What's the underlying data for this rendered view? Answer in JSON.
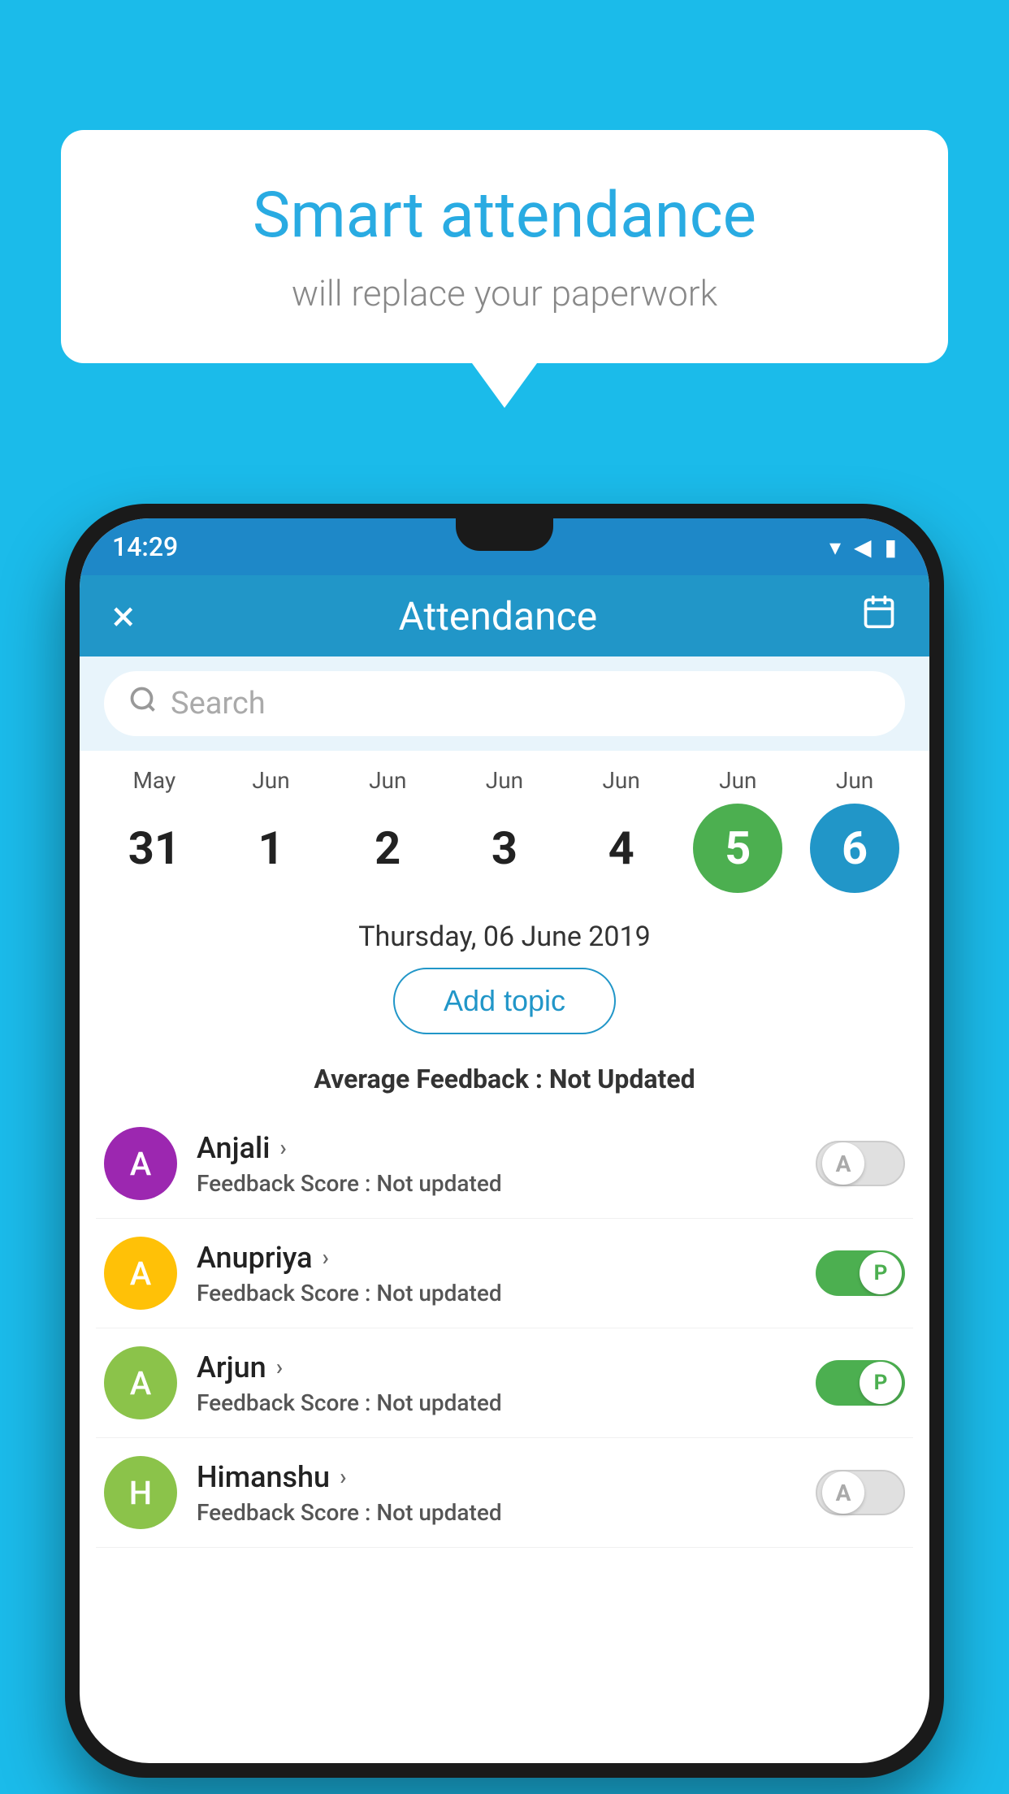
{
  "background_color": "#1BBBEA",
  "speech_bubble": {
    "title": "Smart attendance",
    "subtitle": "will replace your paperwork"
  },
  "status_bar": {
    "time": "14:29",
    "icons": [
      "wifi",
      "signal",
      "battery"
    ]
  },
  "app_bar": {
    "title": "Attendance",
    "close_label": "×",
    "calendar_label": "📅"
  },
  "search": {
    "placeholder": "Search"
  },
  "calendar": {
    "days": [
      {
        "month": "May",
        "date": "31",
        "state": "normal"
      },
      {
        "month": "Jun",
        "date": "1",
        "state": "normal"
      },
      {
        "month": "Jun",
        "date": "2",
        "state": "normal"
      },
      {
        "month": "Jun",
        "date": "3",
        "state": "normal"
      },
      {
        "month": "Jun",
        "date": "4",
        "state": "normal"
      },
      {
        "month": "Jun",
        "date": "5",
        "state": "today"
      },
      {
        "month": "Jun",
        "date": "6",
        "state": "selected"
      }
    ]
  },
  "selected_date": "Thursday, 06 June 2019",
  "add_topic_label": "Add topic",
  "avg_feedback": {
    "label": "Average Feedback : ",
    "value": "Not Updated"
  },
  "students": [
    {
      "name": "Anjali",
      "avatar_letter": "A",
      "avatar_color": "#9C27B0",
      "feedback_label": "Feedback Score : ",
      "feedback_value": "Not updated",
      "toggle_state": "off",
      "toggle_letter": "A"
    },
    {
      "name": "Anupriya",
      "avatar_letter": "A",
      "avatar_color": "#FFC107",
      "feedback_label": "Feedback Score : ",
      "feedback_value": "Not updated",
      "toggle_state": "on-p",
      "toggle_letter": "P"
    },
    {
      "name": "Arjun",
      "avatar_letter": "A",
      "avatar_color": "#8BC34A",
      "feedback_label": "Feedback Score : ",
      "feedback_value": "Not updated",
      "toggle_state": "on-p",
      "toggle_letter": "P"
    },
    {
      "name": "Himanshu",
      "avatar_letter": "H",
      "avatar_color": "#8BC34A",
      "feedback_label": "Feedback Score : ",
      "feedback_value": "Not updated",
      "toggle_state": "off",
      "toggle_letter": "A"
    }
  ]
}
